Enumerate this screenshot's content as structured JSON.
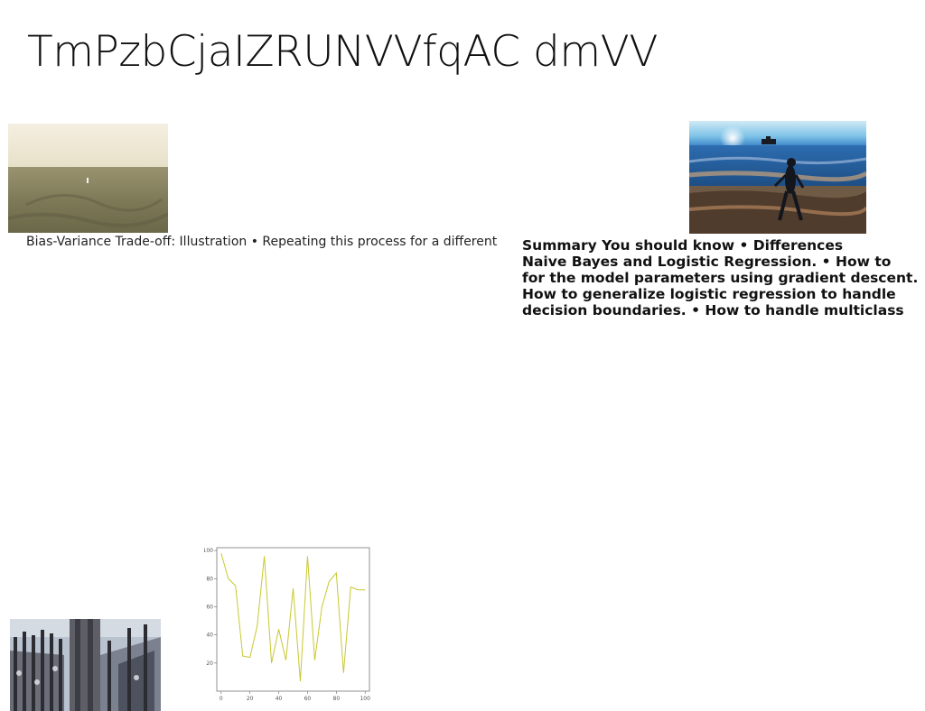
{
  "page": {
    "title": "TmPzbCjaIZRUNVVfqAC dmVV",
    "caption": "Bias-Variance Trade-off: Illustration • Repeating this process for a different",
    "summary_lines": [
      "Summary You should know • Differences",
      "Naive Bayes and Logistic Regression. • How to",
      "for the model parameters using gradient descent.",
      "How to generalize logistic regression to handle",
      "decision boundaries. • How to handle multiclass"
    ]
  },
  "chart_data": {
    "type": "line",
    "x": [
      0,
      5,
      10,
      15,
      20,
      25,
      30,
      35,
      40,
      45,
      50,
      55,
      60,
      65,
      70,
      75,
      80,
      85,
      90,
      95,
      100
    ],
    "series": [
      {
        "values": [
          98,
          80,
          75,
          25,
          24,
          46,
          96,
          20,
          44,
          22,
          73,
          7,
          96,
          22,
          60,
          78,
          84,
          13,
          74,
          72,
          72
        ]
      }
    ],
    "title": "",
    "xlabel": "",
    "ylabel": "",
    "xlim": [
      -3,
      103
    ],
    "ylim": [
      0,
      102
    ],
    "xticks": [
      0,
      20,
      40,
      60,
      80,
      100
    ],
    "yticks": [
      20,
      40,
      60,
      80,
      100
    ],
    "line_color": "#c8c830",
    "grid": false,
    "legend": "none"
  }
}
